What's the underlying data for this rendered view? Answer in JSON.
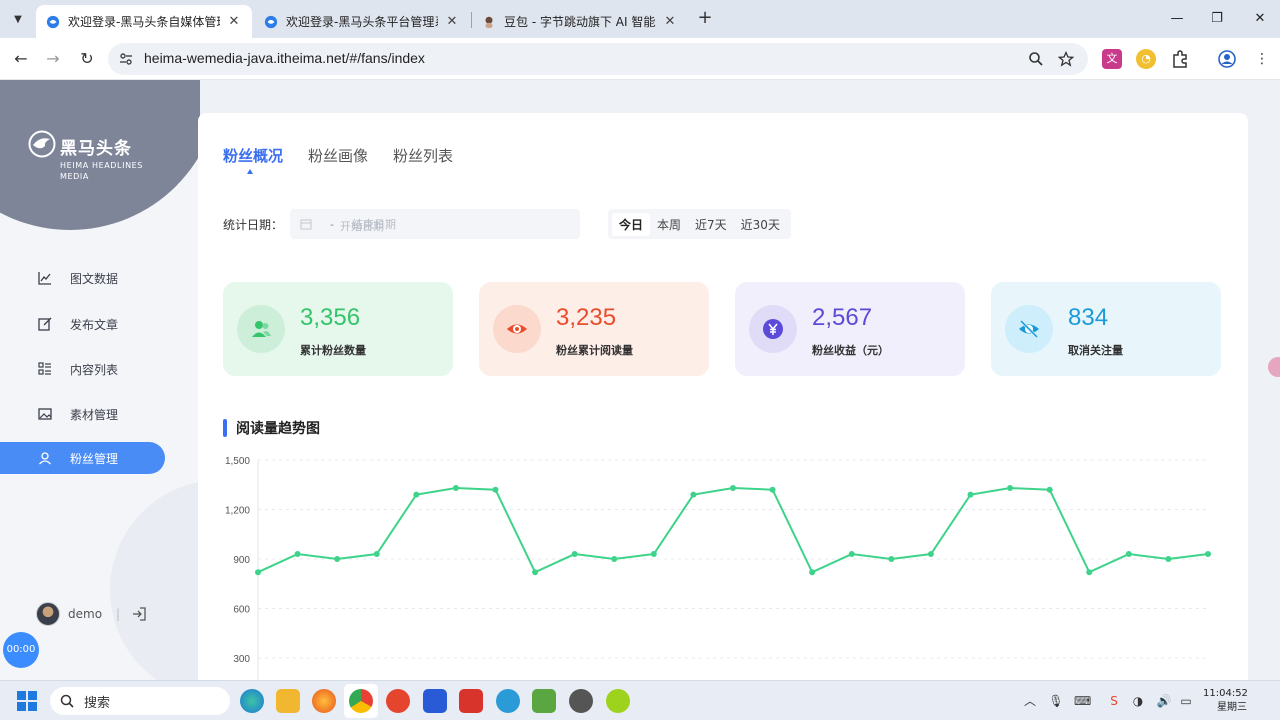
{
  "browser": {
    "tabs": [
      {
        "title": "欢迎登录-黑马头条自媒体管理",
        "active": true
      },
      {
        "title": "欢迎登录-黑马头条平台管理系",
        "active": false
      },
      {
        "title": "豆包 - 字节跳动旗下 AI 智能助",
        "active": false
      }
    ],
    "url": "heima-wemedia-java.itheima.net/#/fans/index"
  },
  "sidebar": {
    "logo_cn": "黑马头条",
    "logo_en": "HEIMA HEADLINES MEDIA",
    "items": [
      {
        "label": "图文数据",
        "icon": "chart-line-icon"
      },
      {
        "label": "发布文章",
        "icon": "edit-icon"
      },
      {
        "label": "内容列表",
        "icon": "list-icon"
      },
      {
        "label": "素材管理",
        "icon": "image-icon"
      },
      {
        "label": "粉丝管理",
        "icon": "user-icon",
        "active": true
      }
    ],
    "user": {
      "name": "demo",
      "separator": "|"
    },
    "timer": "00:00"
  },
  "main": {
    "tabs": [
      {
        "label": "粉丝概况",
        "active": true
      },
      {
        "label": "粉丝画像"
      },
      {
        "label": "粉丝列表"
      }
    ],
    "date_label": "统计日期：",
    "date_start_placeholder": "开始日期",
    "date_separator": "-",
    "date_end_placeholder": "结束日期",
    "quick_ranges": [
      {
        "label": "今日",
        "active": true
      },
      {
        "label": "本周"
      },
      {
        "label": "近7天"
      },
      {
        "label": "近30天"
      }
    ],
    "cards": [
      {
        "value": "3,356",
        "label": "累计粉丝数量",
        "icon": "users-icon",
        "bg": "#e6f7ec",
        "circle": "#cdeed9",
        "accent": "#34c46a"
      },
      {
        "value": "3,235",
        "label": "粉丝累计阅读量",
        "icon": "eye-icon",
        "bg": "#fdeee8",
        "circle": "#fbd9cc",
        "accent": "#ea4c2c"
      },
      {
        "value": "2,567",
        "label": "粉丝收益（元）",
        "icon": "yen-icon",
        "bg": "#f1effb",
        "circle": "#e0dcf7",
        "accent": "#5b4bd8"
      },
      {
        "value": "834",
        "label": "取消关注量",
        "icon": "eye-off-icon",
        "bg": "#e8f6fb",
        "circle": "#cdeefa",
        "accent": "#1a9bd7"
      }
    ],
    "chart_title": "阅读量趋势图"
  },
  "chart_data": {
    "type": "line",
    "title": "阅读量趋势图",
    "xlabel": "",
    "ylabel": "",
    "y_ticks": [
      "1,500",
      "1,200",
      "900",
      "600",
      "300"
    ],
    "ylim": [
      0,
      1500
    ],
    "grid": true,
    "color": "#3ed38a",
    "series": [
      {
        "values": [
          820,
          930,
          900,
          930,
          1290,
          1330,
          1320,
          820,
          930,
          900,
          930,
          1290,
          1330,
          1320,
          820,
          930,
          900,
          930,
          1290,
          1330,
          1320,
          820,
          930,
          900,
          930
        ]
      }
    ]
  },
  "taskbar": {
    "search_placeholder": "搜索",
    "time": "11:04:52",
    "weekday": "星期三"
  }
}
